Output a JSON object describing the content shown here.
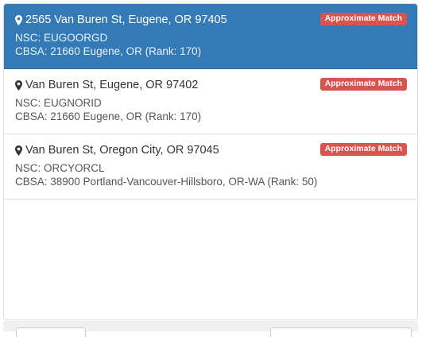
{
  "results": [
    {
      "address": "2565 Van Buren St, Eugene, OR 97405",
      "badge": "Approximate Match",
      "nsc": "NSC: EUGOORGD",
      "cbsa": "CBSA: 21660 Eugene, OR (Rank: 170)",
      "selected": true
    },
    {
      "address": "Van Buren St, Eugene, OR 97402",
      "badge": "Approximate Match",
      "nsc": "NSC: EUGNORID",
      "cbsa": "CBSA: 21660 Eugene, OR (Rank: 170)",
      "selected": false
    },
    {
      "address": "Van Buren St, Oregon City, OR 97045",
      "badge": "Approximate Match",
      "nsc": "NSC: ORCYORCL",
      "cbsa": "CBSA: 38900 Portland-Vancouver-Hillsboro, OR-WA (Rank: 50)",
      "selected": false
    }
  ],
  "icons": {
    "pin": "map-marker-icon"
  },
  "colors": {
    "selected_bg": "#337ab7",
    "badge_bg": "#d9534f",
    "border": "#dddddd"
  }
}
